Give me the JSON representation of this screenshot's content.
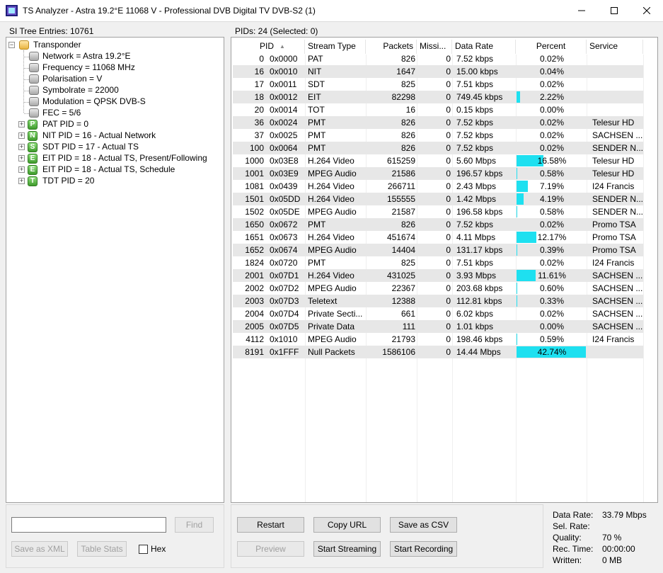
{
  "window": {
    "title": "TS Analyzer - Astra 19.2°E 11068 V - Professional DVB Digital TV DVB-S2 (1)"
  },
  "tree": {
    "header": "SI Tree Entries: 10761",
    "root": "Transponder",
    "details": [
      "Network = Astra 19.2°E",
      "Frequency = 11068 MHz",
      "Polarisation = V",
      "Symbolrate = 22000",
      "Modulation = QPSK DVB-S",
      "FEC = 5/6"
    ],
    "tables": [
      {
        "letter": "P",
        "label": "PAT PID = 0"
      },
      {
        "letter": "N",
        "label": "NIT PID = 16 - Actual Network"
      },
      {
        "letter": "S",
        "label": "SDT PID = 17 - Actual TS"
      },
      {
        "letter": "E",
        "label": "EIT PID = 18 - Actual TS, Present/Following"
      },
      {
        "letter": "E",
        "label": "EIT PID = 18 - Actual TS, Schedule"
      },
      {
        "letter": "T",
        "label": "TDT PID = 20"
      }
    ],
    "collapse_symbol": "−",
    "expand_symbol": "+"
  },
  "pids": {
    "header": "PIDs: 24   (Selected: 0)",
    "sort_indicator": "▲",
    "columns": [
      "PID",
      "Stream Type",
      "Packets",
      "Missi...",
      "Data Rate",
      "Percent",
      "Service"
    ],
    "rows": [
      {
        "pid": "0",
        "hex": "0x0000",
        "type": "PAT",
        "packets": "826",
        "missing": "0",
        "rate": "7.52 kbps",
        "percent": 0.02,
        "percent_text": "0.02%",
        "service": ""
      },
      {
        "pid": "16",
        "hex": "0x0010",
        "type": "NIT",
        "packets": "1647",
        "missing": "0",
        "rate": "15.00 kbps",
        "percent": 0.04,
        "percent_text": "0.04%",
        "service": ""
      },
      {
        "pid": "17",
        "hex": "0x0011",
        "type": "SDT",
        "packets": "825",
        "missing": "0",
        "rate": "7.51 kbps",
        "percent": 0.02,
        "percent_text": "0.02%",
        "service": ""
      },
      {
        "pid": "18",
        "hex": "0x0012",
        "type": "EIT",
        "packets": "82298",
        "missing": "0",
        "rate": "749.45 kbps",
        "percent": 2.22,
        "percent_text": "2.22%",
        "service": ""
      },
      {
        "pid": "20",
        "hex": "0x0014",
        "type": "TOT",
        "packets": "16",
        "missing": "0",
        "rate": "0.15 kbps",
        "percent": 0.0,
        "percent_text": "0.00%",
        "service": ""
      },
      {
        "pid": "36",
        "hex": "0x0024",
        "type": "PMT",
        "packets": "826",
        "missing": "0",
        "rate": "7.52 kbps",
        "percent": 0.02,
        "percent_text": "0.02%",
        "service": "Telesur HD"
      },
      {
        "pid": "37",
        "hex": "0x0025",
        "type": "PMT",
        "packets": "826",
        "missing": "0",
        "rate": "7.52 kbps",
        "percent": 0.02,
        "percent_text": "0.02%",
        "service": "SACHSEN ..."
      },
      {
        "pid": "100",
        "hex": "0x0064",
        "type": "PMT",
        "packets": "826",
        "missing": "0",
        "rate": "7.52 kbps",
        "percent": 0.02,
        "percent_text": "0.02%",
        "service": "SENDER N..."
      },
      {
        "pid": "1000",
        "hex": "0x03E8",
        "type": "H.264 Video",
        "packets": "615259",
        "missing": "0",
        "rate": "5.60 Mbps",
        "percent": 16.58,
        "percent_text": "16.58%",
        "service": "Telesur HD"
      },
      {
        "pid": "1001",
        "hex": "0x03E9",
        "type": "MPEG Audio",
        "packets": "21586",
        "missing": "0",
        "rate": "196.57 kbps",
        "percent": 0.58,
        "percent_text": "0.58%",
        "service": "Telesur HD"
      },
      {
        "pid": "1081",
        "hex": "0x0439",
        "type": "H.264 Video",
        "packets": "266711",
        "missing": "0",
        "rate": "2.43 Mbps",
        "percent": 7.19,
        "percent_text": "7.19%",
        "service": "I24 Francis"
      },
      {
        "pid": "1501",
        "hex": "0x05DD",
        "type": "H.264 Video",
        "packets": "155555",
        "missing": "0",
        "rate": "1.42 Mbps",
        "percent": 4.19,
        "percent_text": "4.19%",
        "service": "SENDER N..."
      },
      {
        "pid": "1502",
        "hex": "0x05DE",
        "type": "MPEG Audio",
        "packets": "21587",
        "missing": "0",
        "rate": "196.58 kbps",
        "percent": 0.58,
        "percent_text": "0.58%",
        "service": "SENDER N..."
      },
      {
        "pid": "1650",
        "hex": "0x0672",
        "type": "PMT",
        "packets": "826",
        "missing": "0",
        "rate": "7.52 kbps",
        "percent": 0.02,
        "percent_text": "0.02%",
        "service": "Promo TSA"
      },
      {
        "pid": "1651",
        "hex": "0x0673",
        "type": "H.264 Video",
        "packets": "451674",
        "missing": "0",
        "rate": "4.11 Mbps",
        "percent": 12.17,
        "percent_text": "12.17%",
        "service": "Promo TSA"
      },
      {
        "pid": "1652",
        "hex": "0x0674",
        "type": "MPEG Audio",
        "packets": "14404",
        "missing": "0",
        "rate": "131.17 kbps",
        "percent": 0.39,
        "percent_text": "0.39%",
        "service": "Promo TSA"
      },
      {
        "pid": "1824",
        "hex": "0x0720",
        "type": "PMT",
        "packets": "825",
        "missing": "0",
        "rate": "7.51 kbps",
        "percent": 0.02,
        "percent_text": "0.02%",
        "service": "I24 Francis"
      },
      {
        "pid": "2001",
        "hex": "0x07D1",
        "type": "H.264 Video",
        "packets": "431025",
        "missing": "0",
        "rate": "3.93 Mbps",
        "percent": 11.61,
        "percent_text": "11.61%",
        "service": "SACHSEN ..."
      },
      {
        "pid": "2002",
        "hex": "0x07D2",
        "type": "MPEG Audio",
        "packets": "22367",
        "missing": "0",
        "rate": "203.68 kbps",
        "percent": 0.6,
        "percent_text": "0.60%",
        "service": "SACHSEN ..."
      },
      {
        "pid": "2003",
        "hex": "0x07D3",
        "type": "Teletext",
        "packets": "12388",
        "missing": "0",
        "rate": "112.81 kbps",
        "percent": 0.33,
        "percent_text": "0.33%",
        "service": "SACHSEN ..."
      },
      {
        "pid": "2004",
        "hex": "0x07D4",
        "type": "Private Secti...",
        "packets": "661",
        "missing": "0",
        "rate": "6.02 kbps",
        "percent": 0.02,
        "percent_text": "0.02%",
        "service": "SACHSEN ..."
      },
      {
        "pid": "2005",
        "hex": "0x07D5",
        "type": "Private Data",
        "packets": "111",
        "missing": "0",
        "rate": "1.01 kbps",
        "percent": 0.0,
        "percent_text": "0.00%",
        "service": "SACHSEN ..."
      },
      {
        "pid": "4112",
        "hex": "0x1010",
        "type": "MPEG Audio",
        "packets": "21793",
        "missing": "0",
        "rate": "198.46 kbps",
        "percent": 0.59,
        "percent_text": "0.59%",
        "service": "I24 Francis"
      },
      {
        "pid": "8191",
        "hex": "0x1FFF",
        "type": "Null Packets",
        "packets": "1586106",
        "missing": "0",
        "rate": "14.44 Mbps",
        "percent": 42.74,
        "percent_text": "42.74%",
        "service": ""
      }
    ]
  },
  "controls": {
    "search_value": "",
    "find_label": "Find",
    "save_xml_label": "Save as XML",
    "table_stats_label": "Table Stats",
    "hex_label": "Hex",
    "restart_label": "Restart",
    "copy_url_label": "Copy URL",
    "save_csv_label": "Save as CSV",
    "preview_label": "Preview",
    "start_streaming_label": "Start Streaming",
    "start_recording_label": "Start Recording"
  },
  "stats": [
    {
      "label": "Data Rate:",
      "value": "33.79 Mbps"
    },
    {
      "label": "Sel. Rate:",
      "value": ""
    },
    {
      "label": "Quality:",
      "value": "70 %"
    },
    {
      "label": "Rec. Time:",
      "value": "00:00:00"
    },
    {
      "label": "Written:",
      "value": "0 MB"
    }
  ],
  "colors": {
    "bar": "#1ee0f0",
    "alt_row": "#e7e7e7"
  }
}
